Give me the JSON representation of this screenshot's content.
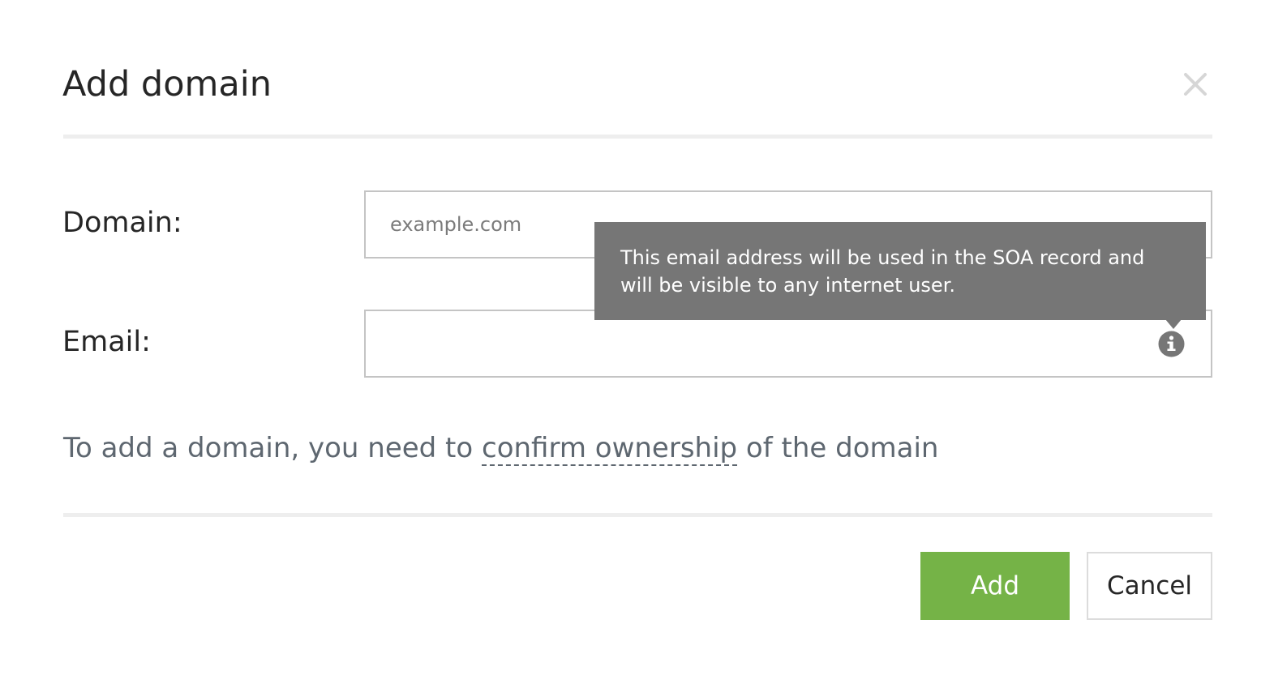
{
  "dialog": {
    "title": "Add domain",
    "close_icon": "close-icon"
  },
  "form": {
    "domain_label": "Domain:",
    "domain_placeholder": "example.com",
    "domain_value": "",
    "email_label": "Email:",
    "email_value": "",
    "email_info_icon": "info-icon"
  },
  "tooltip": {
    "text": "This email address will be used in the SOA record and will be visible to any internet user."
  },
  "note": {
    "prefix": "To add a domain, you need to ",
    "link_text": "confirm ownership",
    "suffix": " of the domain"
  },
  "actions": {
    "add_label": "Add",
    "cancel_label": "Cancel"
  },
  "colors": {
    "primary_button": "#75b347",
    "tooltip_background": "#767676",
    "divider": "#eeeeee",
    "muted_text": "#5e6770"
  }
}
